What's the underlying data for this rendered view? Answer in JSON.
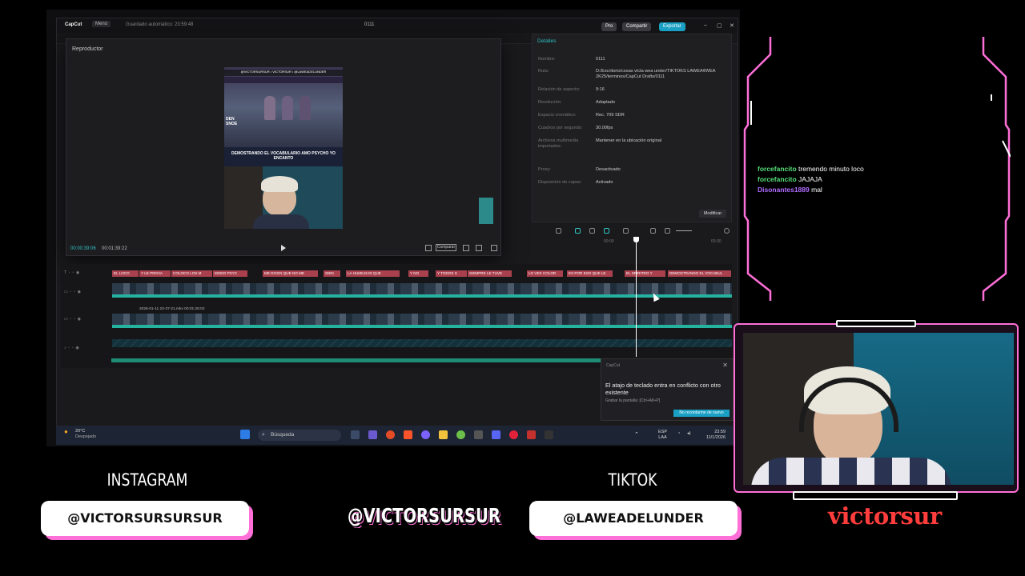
{
  "capcut": {
    "logo": "CapCut",
    "menu": "Menú",
    "autosave": "Guardado automático: 23:59:48",
    "project_name": "0111",
    "pro": "Pro",
    "share": "Compartir",
    "export": "Exportar"
  },
  "player": {
    "title": "Reproductor",
    "preview_banner": "@VICTORSURSUR • VICTORSUR • @LAWEADELUNDER",
    "preview_caption": "DEMOSTRANDO EL VOCABULARIO AMO PSYCHO YO ENCANTO",
    "preview_side_text": "DEN SNOE",
    "current_time": "00:00:39:06",
    "total_time": "00:01:39:22",
    "compare_label": "Comparar"
  },
  "details": {
    "header": "Detalles",
    "rows": [
      {
        "key": "Nombre:",
        "value": "0111"
      },
      {
        "key": "Ruta:",
        "value": "D:/Escritorio/cosas victa wea under/TIKTOKS LAWEA¢WEA 2K25/terminos/CapCut Drafts/0111"
      },
      {
        "key": "Relación de aspecto:",
        "value": "9:16"
      },
      {
        "key": "Resolución:",
        "value": "Adaptado"
      },
      {
        "key": "Espacio cromático:",
        "value": "Rec. 709 SDR"
      },
      {
        "key": "Cuadros por segundo:",
        "value": "30.00fps"
      },
      {
        "key": "Archivos multimedia importados:",
        "value": "Mantener en la ubicación original"
      },
      {
        "key": "Proxy:",
        "value": "Desactivado"
      },
      {
        "key": "Disposición de capas:",
        "value": "Activado"
      }
    ],
    "modify_button": "Modificar"
  },
  "timeline": {
    "ruler": [
      "00:00",
      "00:30"
    ],
    "text_clips": [
      "EL LOCO",
      "Y LE PROVA",
      "COLOCO LOS M",
      "MODO PSYC",
      "ME DICEN QUE NO ME",
      "SIEN",
      "LA HUMILDAD QUE",
      "Y NO",
      "Y TODOS S",
      "SIEMPRE LE TUVE",
      "LO VES COLOR",
      "ES POR ESO QUE LE",
      "EL SPIRITRO Y",
      "DEMOSTRANDO EL VOCABUL"
    ],
    "clip_label": "2026-01-11 23-37-21.mkv   00:01:26:02"
  },
  "toast": {
    "app": "CapCut",
    "message": "El atajo de teclado entra en conflicto con otro existente",
    "sub": "Grabar la pantalla: [Ctrl+Alt+P]",
    "button": "No recordarme de nuevo"
  },
  "taskbar": {
    "temp": "20°C",
    "weather": "Despejado",
    "search": "Búsqueda",
    "lang": "ESP",
    "region": "LAA",
    "time": "23:59",
    "date": "11/1/2026"
  },
  "chat": [
    {
      "user": "forcefancito",
      "text": "tremendo minuto loco"
    },
    {
      "user": "forcefancito",
      "text": "JAJAJA"
    },
    {
      "user": "Disonantes1889",
      "text": "mal"
    }
  ],
  "overlay": {
    "instagram_label": "INSTAGRAM",
    "instagram_handle": "@VICTORSURSURSUR",
    "center_handle": "@VICTORSURSUR",
    "tiktok_label": "TIKTOK",
    "tiktok_handle": "@LAWEADELUNDER",
    "brand": "victorsur"
  },
  "colors": {
    "accent_pink": "#ff6fd8",
    "capcut_teal": "#2fc0c0",
    "brand_red": "#ff3d3d",
    "chat_green": "#55e07a",
    "chat_purple": "#b06cff"
  }
}
